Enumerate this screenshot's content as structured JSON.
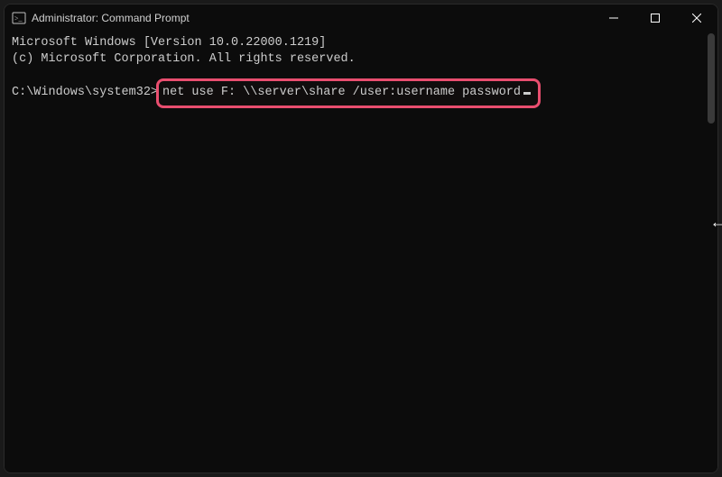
{
  "window": {
    "title": "Administrator: Command Prompt"
  },
  "terminal": {
    "line1": "Microsoft Windows [Version 10.0.22000.1219]",
    "line2": "(c) Microsoft Corporation. All rights reserved.",
    "prompt_path": "C:\\Windows\\system32>",
    "command": "net use F: \\\\server\\share /user:username password"
  },
  "overlay": {
    "arrow": "←"
  }
}
